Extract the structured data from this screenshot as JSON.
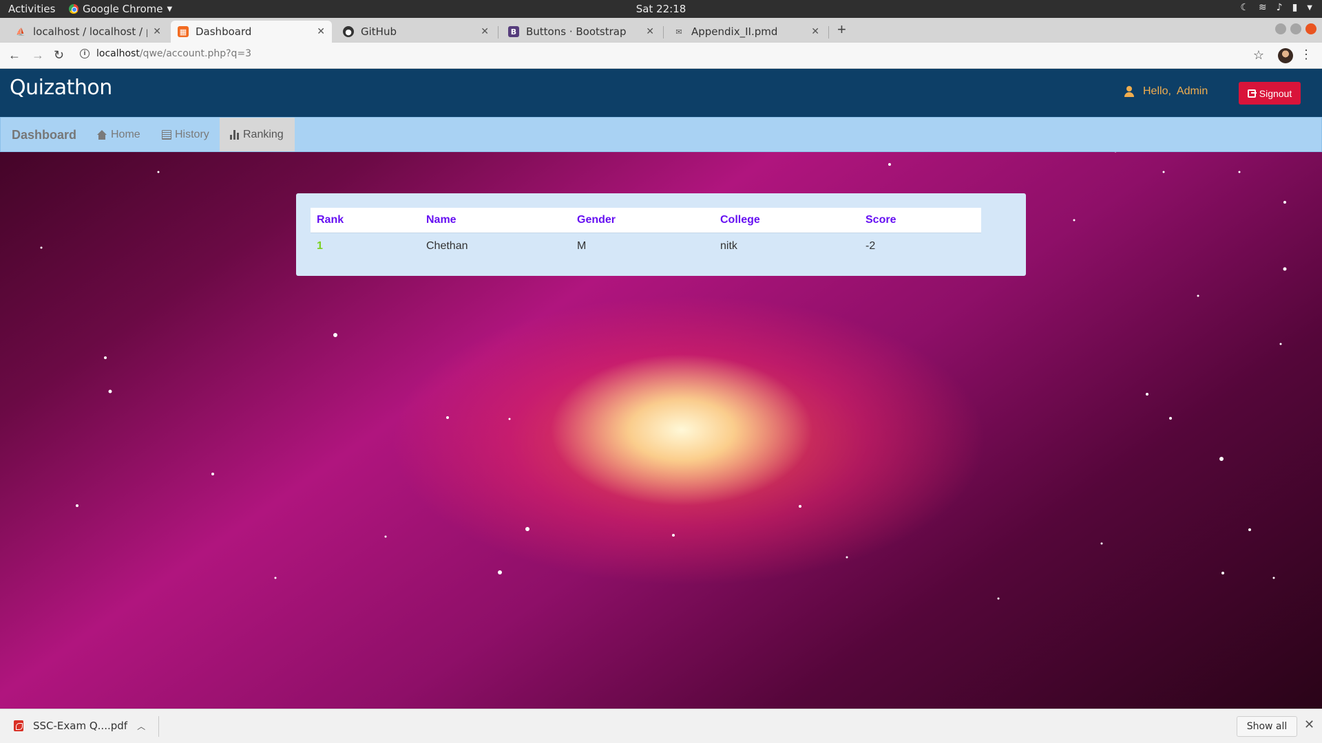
{
  "system": {
    "activities": "Activities",
    "app_name": "Google Chrome",
    "clock": "Sat 22:18"
  },
  "tabs": [
    {
      "title": "localhost / localhost / pro",
      "icon": "phpmyadmin-icon"
    },
    {
      "title": "Dashboard",
      "icon": "page-icon",
      "active": true
    },
    {
      "title": "GitHub",
      "icon": "github-icon"
    },
    {
      "title": "Buttons · Bootstrap",
      "icon": "bootstrap-icon"
    },
    {
      "title": "Appendix_II.pmd",
      "icon": "document-icon"
    }
  ],
  "address": {
    "host": "localhost",
    "path": "/qwe/account.php?q=3"
  },
  "site": {
    "brand": "Quizathon",
    "hello": "Hello,",
    "username": "Admin",
    "signout": "Signout"
  },
  "nav": {
    "brand": "Dashboard",
    "home": "Home",
    "history": "History",
    "ranking": "Ranking",
    "active": "ranking"
  },
  "ranking_table": {
    "headers": [
      "Rank",
      "Name",
      "Gender",
      "College",
      "Score"
    ],
    "rows": [
      [
        "1",
        "Chethan",
        "M",
        "nitk",
        "-2"
      ]
    ]
  },
  "downloads": {
    "file": "SSC-Exam Q....pdf",
    "show_all": "Show all"
  },
  "colors": {
    "header_bg": "#0d3f67",
    "navbar_bg": "#a9d2f3",
    "signout_bg": "#d9143a",
    "table_header_text": "#6610f2",
    "rank_text": "#7bd11f",
    "hello_text": "#f0ad4e"
  }
}
